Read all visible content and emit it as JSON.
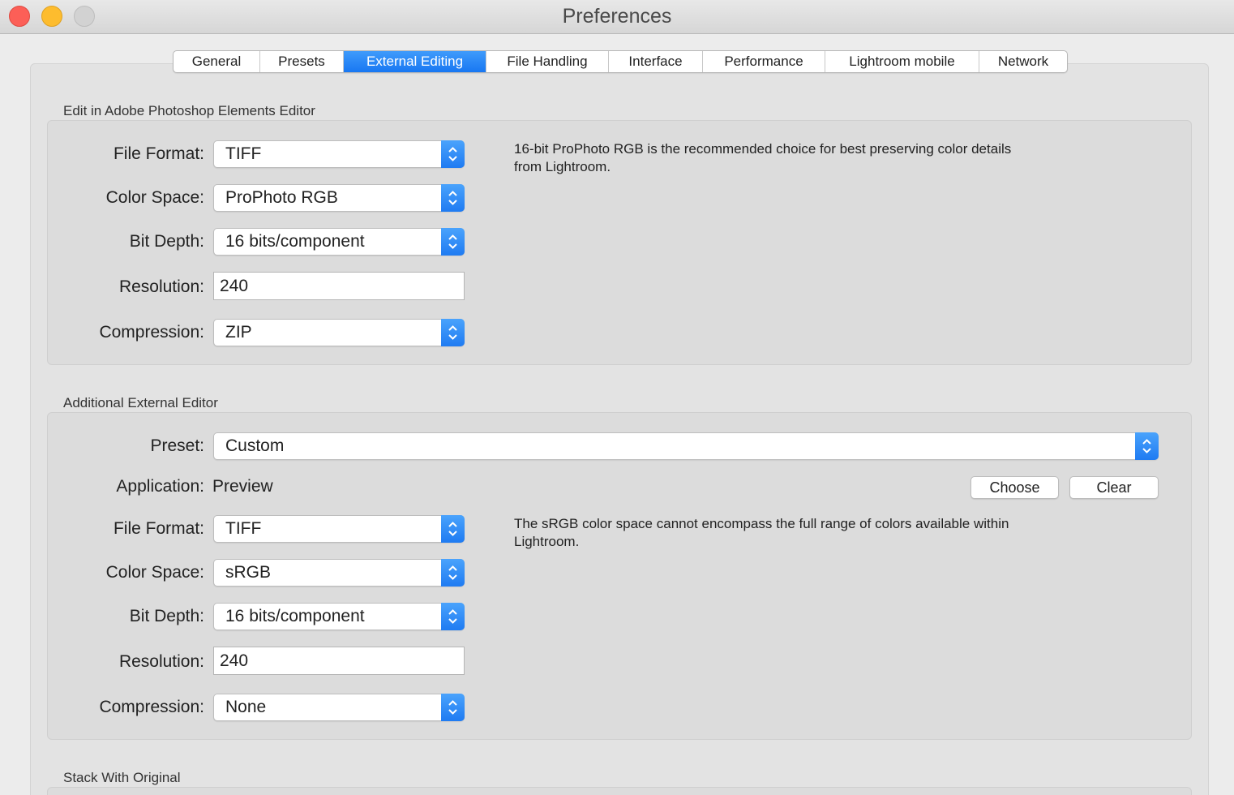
{
  "window": {
    "title": "Preferences"
  },
  "tabs": [
    {
      "label": "General"
    },
    {
      "label": "Presets"
    },
    {
      "label": "External Editing"
    },
    {
      "label": "File Handling"
    },
    {
      "label": "Interface"
    },
    {
      "label": "Performance"
    },
    {
      "label": "Lightroom mobile"
    },
    {
      "label": "Network"
    }
  ],
  "active_tab": "External Editing",
  "section1": {
    "title": "Edit in Adobe Photoshop Elements Editor",
    "file_format": {
      "label": "File Format:",
      "value": "TIFF"
    },
    "color_space": {
      "label": "Color Space:",
      "value": "ProPhoto RGB"
    },
    "bit_depth": {
      "label": "Bit Depth:",
      "value": "16 bits/component"
    },
    "resolution": {
      "label": "Resolution:",
      "value": "240"
    },
    "compression": {
      "label": "Compression:",
      "value": "ZIP"
    },
    "note": "16-bit ProPhoto RGB is the recommended choice for best preserving color details from Lightroom."
  },
  "section2": {
    "title": "Additional External Editor",
    "preset": {
      "label": "Preset:",
      "value": "Custom"
    },
    "application": {
      "label": "Application:",
      "value": "Preview"
    },
    "choose_label": "Choose",
    "clear_label": "Clear",
    "file_format": {
      "label": "File Format:",
      "value": "TIFF"
    },
    "color_space": {
      "label": "Color Space:",
      "value": "sRGB"
    },
    "bit_depth": {
      "label": "Bit Depth:",
      "value": "16 bits/component"
    },
    "resolution": {
      "label": "Resolution:",
      "value": "240"
    },
    "compression": {
      "label": "Compression:",
      "value": "None"
    },
    "note": "The sRGB color space cannot encompass the full range of colors available within Lightroom."
  },
  "section3": {
    "title": "Stack With Original"
  },
  "colors": {
    "accent": "#1877f2",
    "close": "#fc5f57",
    "minimize": "#fdbc2e",
    "maximize": "#d2d2d2"
  },
  "icons": {
    "select_arrows": "chevron-up-down-icon"
  }
}
